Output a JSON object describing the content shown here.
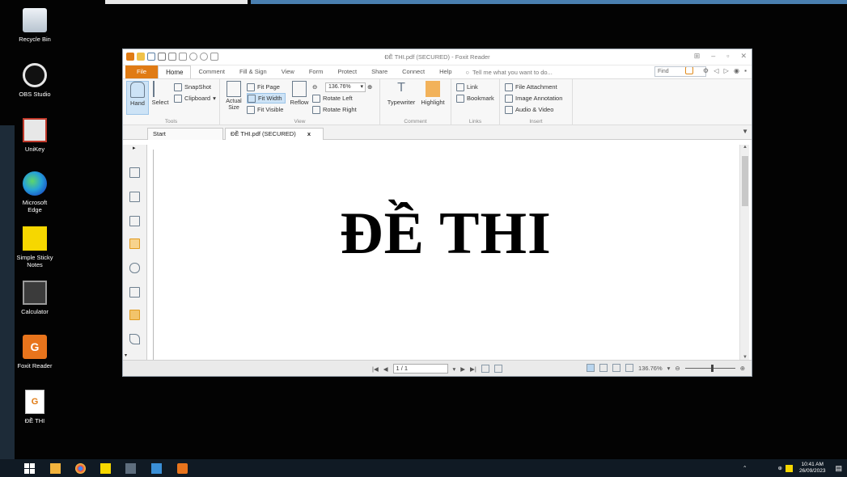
{
  "desktop": {
    "icons": [
      {
        "label": "Recycle Bin",
        "icon": "recycle-bin-icon"
      },
      {
        "label": "OBS Studio",
        "icon": "obs-icon"
      },
      {
        "label": "UniKey",
        "icon": "unikey-icon"
      },
      {
        "label": "Microsoft Edge",
        "icon": "edge-icon"
      },
      {
        "label": "Simple Sticky Notes",
        "icon": "sticky-notes-icon"
      },
      {
        "label": "Calculator",
        "icon": "calculator-icon"
      },
      {
        "label": "Foxit Reader",
        "icon": "foxit-icon"
      },
      {
        "label": "ĐỀ THI",
        "icon": "pdf-file-icon"
      }
    ]
  },
  "window": {
    "title": "ĐỀ THI.pdf (SECURED) - Foxit Reader",
    "menu": {
      "file": "File",
      "items": [
        "Home",
        "Comment",
        "Fill & Sign",
        "View",
        "Form",
        "Protect",
        "Share",
        "Connect",
        "Help"
      ],
      "active": "Home",
      "tell_me": "Tell me what you want to do...",
      "find_placeholder": "Find"
    },
    "ribbon": {
      "tools": {
        "hand": "Hand",
        "select": "Select",
        "snapshot": "SnapShot",
        "clipboard": "Clipboard",
        "label": "Tools"
      },
      "view": {
        "actual_size": "Actual Size",
        "fit_page": "Fit Page",
        "fit_width": "Fit Width",
        "fit_visible": "Fit Visible",
        "reflow": "Reflow",
        "zoom": "136.76%",
        "rotate_left": "Rotate Left",
        "rotate_right": "Rotate Right",
        "label": "View"
      },
      "comment": {
        "typewriter": "Typewriter",
        "highlight": "Highlight",
        "label": "Comment"
      },
      "links": {
        "link": "Link",
        "bookmark": "Bookmark",
        "label": "Links"
      },
      "insert": {
        "file_attachment": "File Attachment",
        "image_annotation": "Image Annotation",
        "audio_video": "Audio & Video",
        "label": "Insert"
      }
    },
    "tabs": [
      {
        "label": "Start"
      },
      {
        "label": "ĐỀ THI.pdf (SECURED)",
        "close": "x"
      }
    ],
    "document": {
      "heading": "ĐỀ THI"
    },
    "status": {
      "page": "1 / 1",
      "zoom": "136.76%"
    }
  },
  "taskbar": {
    "time": "10:41 AM",
    "date": "26/09/2023"
  },
  "colors": {
    "accent": "#e07b14",
    "taskbar": "#101a24",
    "selected": "#cde3f6"
  }
}
